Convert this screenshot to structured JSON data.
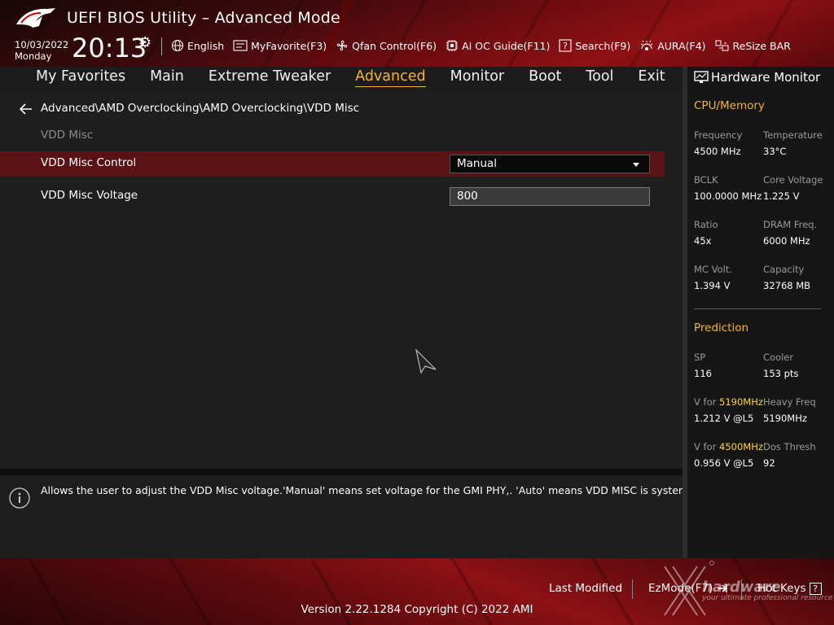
{
  "header": {
    "title": "UEFI BIOS Utility – Advanced Mode",
    "date": "10/03/2022",
    "day": "Monday",
    "time": "20:13"
  },
  "toolbar": {
    "items": [
      {
        "label": "English",
        "icon": "globe-icon"
      },
      {
        "label": "MyFavorite(F3)",
        "icon": "favorite-icon"
      },
      {
        "label": "Qfan Control(F6)",
        "icon": "fan-icon"
      },
      {
        "label": "AI OC Guide(F11)",
        "icon": "chip-icon"
      },
      {
        "label": "Search(F9)",
        "icon": "search-icon"
      },
      {
        "label": "AURA(F4)",
        "icon": "aura-icon"
      },
      {
        "label": "ReSize BAR",
        "icon": "resize-bar-icon"
      }
    ]
  },
  "menu": {
    "tabs": [
      "My Favorites",
      "Main",
      "Extreme Tweaker",
      "Advanced",
      "Monitor",
      "Boot",
      "Tool",
      "Exit"
    ],
    "active": "Advanced"
  },
  "page": {
    "breadcrumb": "Advanced\\AMD Overclocking\\AMD Overclocking\\VDD Misc",
    "section": "VDD Misc",
    "settings": [
      {
        "label": "VDD Misc Control",
        "value": "Manual"
      },
      {
        "label": "VDD Misc Voltage",
        "value": "800"
      }
    ]
  },
  "help": {
    "text": "Allows the user to adjust the VDD Misc voltage.'Manual' means set voltage for the GMI PHY,. 'Auto' means VDD MISC is system default."
  },
  "hardware_monitor": {
    "title": "Hardware Monitor",
    "cpu_memory": {
      "heading": "CPU/Memory",
      "frequency_label": "Frequency",
      "frequency": "4500 MHz",
      "temperature_label": "Temperature",
      "temperature": "33°C",
      "bclk_label": "BCLK",
      "bclk": "100.0000 MHz",
      "core_voltage_label": "Core Voltage",
      "core_voltage": "1.225 V",
      "ratio_label": "Ratio",
      "ratio": "45x",
      "dram_freq_label": "DRAM Freq.",
      "dram_freq": "6000 MHz",
      "mc_volt_label": "MC Volt.",
      "mc_volt": "1.394 V",
      "capacity_label": "Capacity",
      "capacity": "32768 MB"
    },
    "prediction": {
      "heading": "Prediction",
      "sp_label": "SP",
      "sp": "116",
      "cooler_label": "Cooler",
      "cooler": "153 pts",
      "v_for_label": "V for",
      "v_for_1_freq": "5190MHz",
      "v_for_1": "1.212 V @L5",
      "heavy_freq_label": "Heavy Freq",
      "heavy_freq": "5190MHz",
      "v_for_2_freq": "4500MHz",
      "v_for_2": "0.956 V @L5",
      "dos_thresh_label": "Dos Thresh",
      "dos_thresh": "92"
    }
  },
  "footer": {
    "last_modified": "Last Modified",
    "ezmode": "EzMode(F7)",
    "hot_keys": "Hot Keys",
    "hot_keys_key": "?",
    "version": "Version 2.22.1284 Copyright (C) 2022 AMI"
  },
  "watermark": {
    "text": "hardware",
    "sub": "your ultimate professional resource"
  },
  "colors": {
    "accent": "#f5b330",
    "highlight_row": "#5a1214",
    "prediction_freq": "#ffd23c"
  }
}
